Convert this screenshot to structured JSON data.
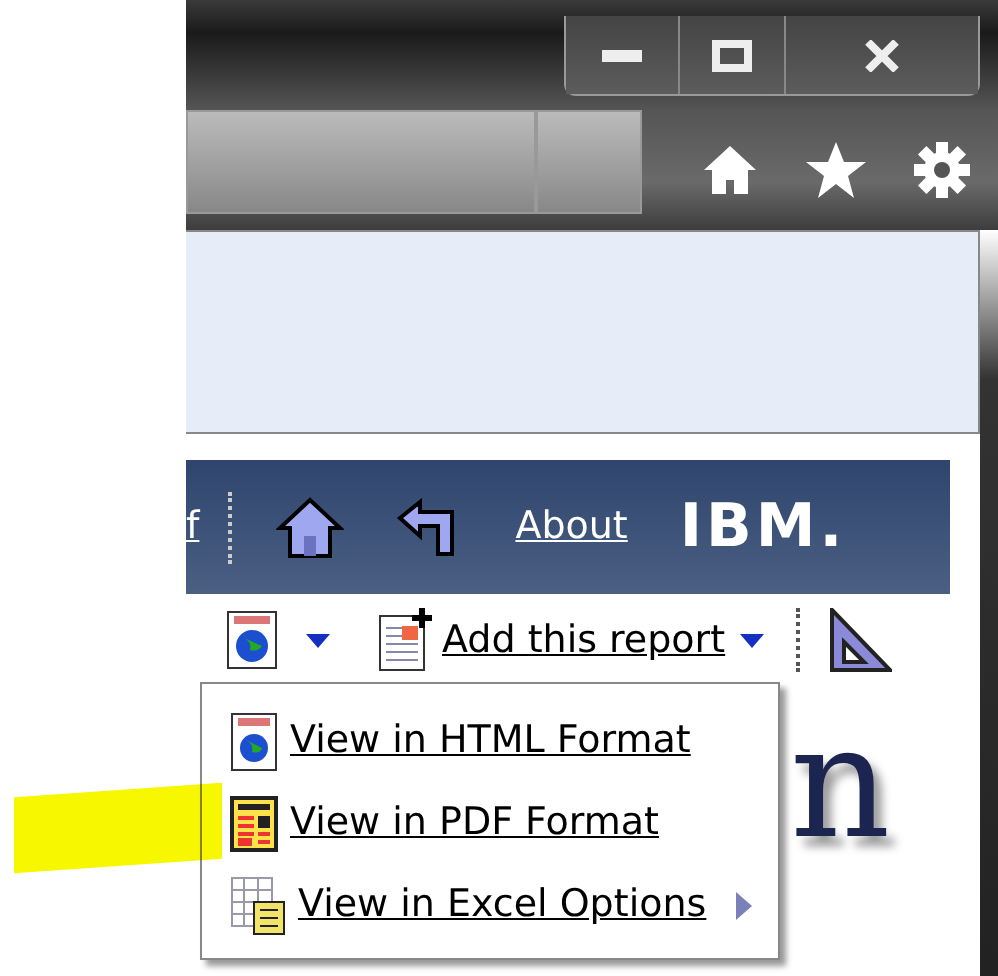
{
  "banner": {
    "cut_link": "f",
    "about_link": "About",
    "logo": "IBM."
  },
  "toolbar": {
    "add_report": "Add this report"
  },
  "menu": {
    "items": [
      {
        "label": "View in HTML Format",
        "kind": "html",
        "submenu": false,
        "highlighted": false
      },
      {
        "label": "View in PDF Format",
        "kind": "pdf",
        "submenu": false,
        "highlighted": true
      },
      {
        "label": "View in Excel Options",
        "kind": "excel",
        "submenu": true,
        "highlighted": false
      }
    ]
  },
  "background_text": "n"
}
